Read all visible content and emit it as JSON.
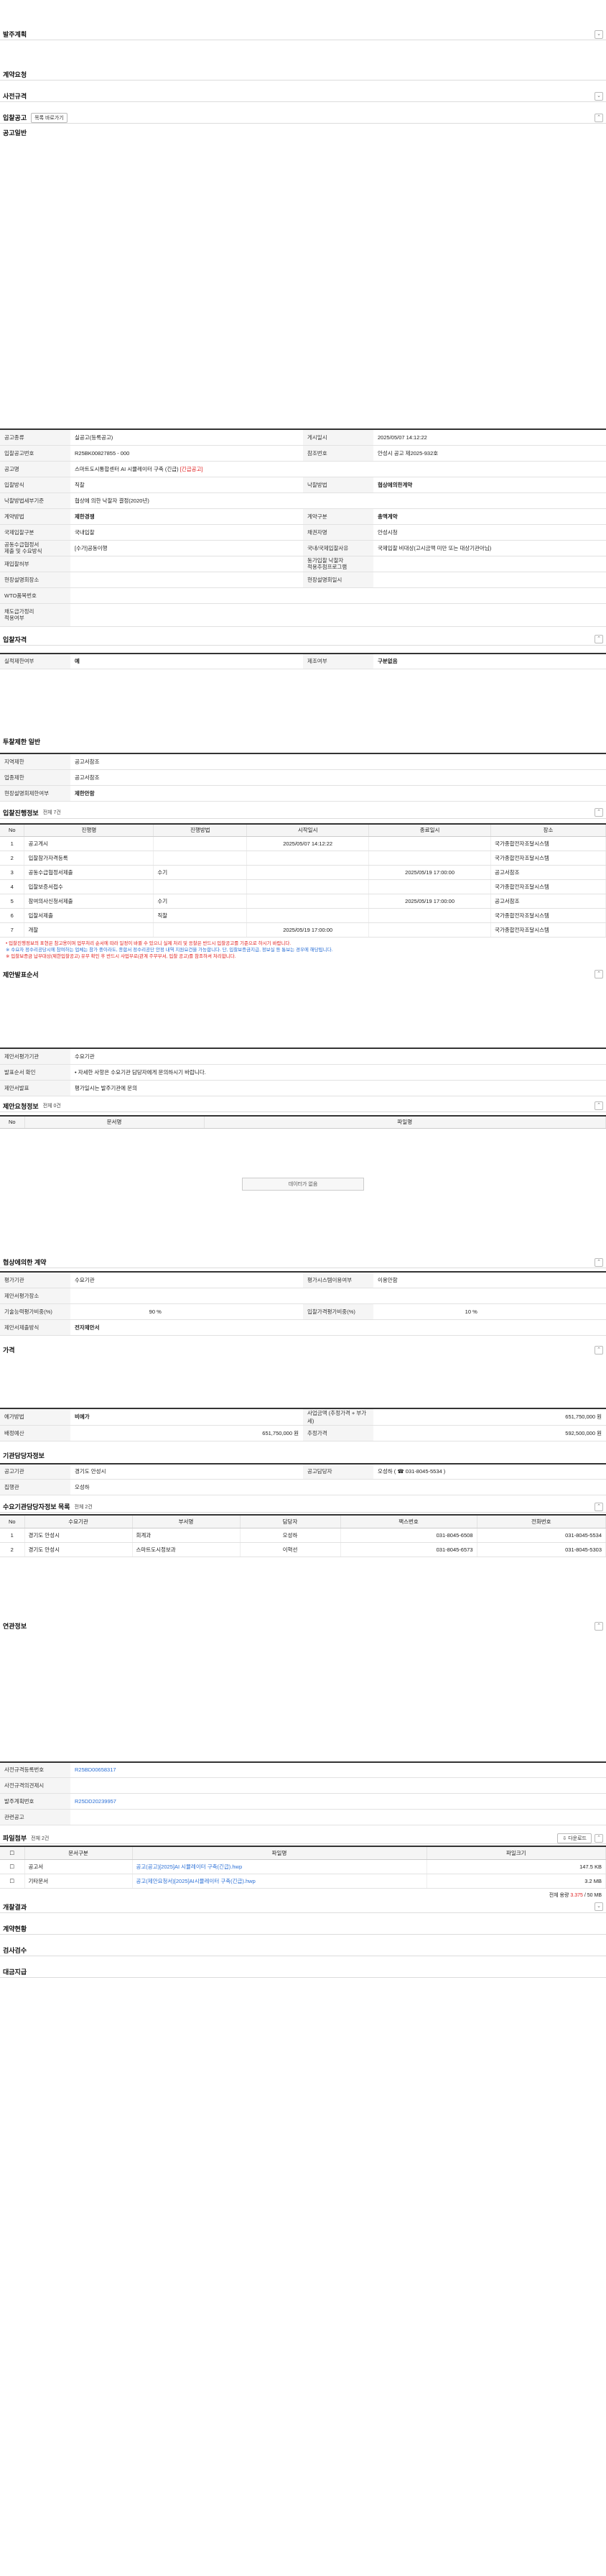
{
  "sections": {
    "order_plan": "발주계획",
    "contract_request": "계약요청",
    "pre_spec": "사전규격",
    "bid_notice": "입찰공고",
    "notice_general": "공고일반",
    "bid_qual": "입찰자격",
    "invest_limit": "투찰제한 일반",
    "bid_progress": "입찰진행정보",
    "proposal": "제안발표순서",
    "proposal_req": "제안요청정보",
    "nego_contract": "협상에의한 계약",
    "price": "가격",
    "agency_contact": "기관담당자정보",
    "demand_contact": "수요기관담당자정보 목록",
    "related": "연관정보",
    "attach": "파일첨부",
    "opening": "개찰결과",
    "contract": "계약현황",
    "inspection": "검사검수",
    "payment": "대금지급"
  },
  "bid_notice_btn": "목록 바로가기",
  "notice": {
    "r1": {
      "k1": "공고종류",
      "v1": "실공고(등록공고)",
      "k2": "게시일시",
      "v2": "2025/05/07 14:12:22"
    },
    "r2": {
      "k1": "입찰공고번호",
      "v1": "R25BK00827855 - 000",
      "k2": "참조번호",
      "v2": "안성시 공고 제2025-932호"
    },
    "r3": {
      "k1": "공고명",
      "v1": "스마트도시통합센터 AI 시뮬레이터 구축 (긴급)",
      "tag": "[긴급공고]"
    },
    "r4": {
      "k1": "입찰방식",
      "v1": "직찰",
      "k2": "낙찰방법",
      "v2": "협상에의한계약"
    },
    "r5": {
      "k1": "낙찰방법세부기준",
      "v1": "협상에 의한 낙찰자 결정(2020년)"
    },
    "r6": {
      "k1": "계약방법",
      "v1": "제한경쟁",
      "k2": "계약구분",
      "v2": "총액계약"
    },
    "r7": {
      "k1": "국제입찰구분",
      "v1": "국내입찰",
      "k2": "채권자명",
      "v2": "안성시청"
    },
    "r8": {
      "k1": "공동수급협정서\n제출 및 수요방식",
      "v1": "[수가]공동이행",
      "k2": "국내/국제입찰사유",
      "v2": "국제입찰 비대상(고시금액 미만 또는 대상기관아님)"
    },
    "r9": {
      "k1": "재입찰허부",
      "v1": "",
      "k2": "동가입찰 낙찰자\n적용추첨프로그램",
      "v2": ""
    },
    "r10": {
      "k1": "현장설명회장소",
      "v1": "",
      "k2": "현장설명회일시",
      "v2": ""
    },
    "r11": {
      "k1": "WTO품목번호",
      "v1": ""
    },
    "r12": {
      "k1": "채도급가정리\n적용여부",
      "v1": ""
    }
  },
  "qual": {
    "k1": "실적제한여부",
    "v1": "예",
    "k2": "제조여부",
    "v2": "구분없음"
  },
  "limit": {
    "r1": {
      "k": "지역제한",
      "v": "공고서참조"
    },
    "r2": {
      "k": "업종제한",
      "v": "공고서참조"
    },
    "r3": {
      "k": "현장설명회제한여부",
      "v": "제한안함"
    }
  },
  "progress": {
    "count": "전체 7건",
    "cols": [
      "No",
      "진행명",
      "진행방법",
      "시작일시",
      "종료일시",
      "장소"
    ],
    "rows": [
      [
        "1",
        "공고게시",
        "",
        "2025/05/07 14:12:22",
        "",
        "국가종합전자조달시스템"
      ],
      [
        "2",
        "입찰참가자격등록",
        "",
        "",
        "",
        "국가종합전자조달시스템"
      ],
      [
        "3",
        "공동수급협정서제출",
        "수기",
        "",
        "2025/05/19 17:00:00",
        "공고서참조"
      ],
      [
        "4",
        "입찰보증서접수",
        "",
        "",
        "",
        "국가종합전자조달시스템"
      ],
      [
        "5",
        "참여의사신청서제출",
        "수기",
        "",
        "2025/05/19 17:00:00",
        "공고서참조"
      ],
      [
        "6",
        "입찰서제출",
        "직찰",
        "",
        "",
        "국가종합전자조달시스템"
      ],
      [
        "7",
        "개찰",
        "",
        "2025/05/19 17:00:00",
        "",
        "국가종합전자조달시스템"
      ]
    ],
    "notes": [
      "• 입찰진행정보의 표현은 참고용이며 업무처리 순서에 따라 일정이 바뀔 수 있으니 실제 처리 및 응찰은 반드시 입찰공고를 기준으로 하시기 바랍니다.",
      "※ 수요자 정수리공당시에 참여하는 업체는 참가 중이라도, 종합서 정수리공단 안정 내역 지원요건을 가능합니다. 단, 입찰보증금지급, 정보실 등 통보는 경우에 해당됩니다.",
      "※ 입찰보증금 납부대상(제한입찰공고) 유무 확인 후 반드시 사업부로(관계 주무부서, 입찰 공고)를 참조하셔 처리합니다."
    ]
  },
  "proposal_order": {
    "r1": {
      "k": "제안서평가기관",
      "v": "수요기관"
    },
    "r2": {
      "k": "발표순서 확인",
      "v": "• 자세한 사항은 수요기관 담당자에게 문의하시기 바랍니다."
    },
    "r3": {
      "k": "제안서발표",
      "v": "평가일시는 발주기관에 문의"
    }
  },
  "proposal_req": {
    "count": "전체 0건",
    "cols": [
      "No",
      "문서명",
      "파일명"
    ],
    "empty": "데이터가 없음"
  },
  "nego": {
    "r1": {
      "k1": "평가기관",
      "v1": "수요기관",
      "k2": "평가시스템이용여부",
      "v2": "이용안함"
    },
    "r2": {
      "k1": "제안서평가장소",
      "v1": ""
    },
    "r3": {
      "k1": "기술능력평가비중(%)",
      "v1": "90",
      "u1": "%",
      "k2": "입찰가격평가비중(%)",
      "v2": "10",
      "u2": "%"
    },
    "r4": {
      "k1": "제안서제출방식",
      "v1": "전자제안서"
    }
  },
  "price": {
    "r1": {
      "k1": "예가방법",
      "v1": "비예가",
      "k2": "사업금액 (추정가격 + 부가세)",
      "v2": "651,750,000 원"
    },
    "r2": {
      "k1": "배정예산",
      "v1": "651,750,000 원",
      "k2": "추정가격",
      "v2": "592,500,000 원"
    }
  },
  "agency": {
    "r1": {
      "k1": "공고기관",
      "v1": "경기도 안성시",
      "k2": "공고담당자",
      "v2": "오성하 ( ☎ 031-8045-5534 )"
    },
    "r2": {
      "k1": "집행관",
      "v1": "오성하"
    }
  },
  "demand": {
    "count": "전체 2건",
    "cols": [
      "No",
      "수요기관",
      "부서명",
      "담당자",
      "팩스번호",
      "전화번호"
    ],
    "rows": [
      [
        "1",
        "경기도 안성시",
        "회계과",
        "오성하",
        "031-8045-6508",
        "031-8045-5534"
      ],
      [
        "2",
        "경기도 안성시",
        "스마트도시정보과",
        "이혁선",
        "031-8045-6573",
        "031-8045-5303"
      ]
    ]
  },
  "related": {
    "r1": {
      "k": "사전규격등록번호",
      "v": "R25BD00658317"
    },
    "r2": {
      "k": "사전규격의견제시",
      "v": ""
    },
    "r3": {
      "k": "발주계획번호",
      "v": "R25DD20239957"
    },
    "r4": {
      "k": "관련공고",
      "v": ""
    }
  },
  "attach": {
    "count": "전체 2건",
    "download": "다운로드",
    "cols": [
      "",
      "문서구분",
      "파일명",
      "파일크기"
    ],
    "rows": [
      [
        "공고서",
        "공고(공고)[2025]AI 시뮬레이터 구축(긴급).hwp",
        "147.5 KB"
      ],
      [
        "기타문서",
        "공고(제안요청서)[2025]AI시뮬레이터 구축(긴급).hwp",
        "3.2 MB"
      ]
    ],
    "total_label": "전체 용량",
    "total_used": "3.375",
    "total_max": "/ 50 MB"
  },
  "icons": {
    "toggle": "chevron-icon"
  }
}
